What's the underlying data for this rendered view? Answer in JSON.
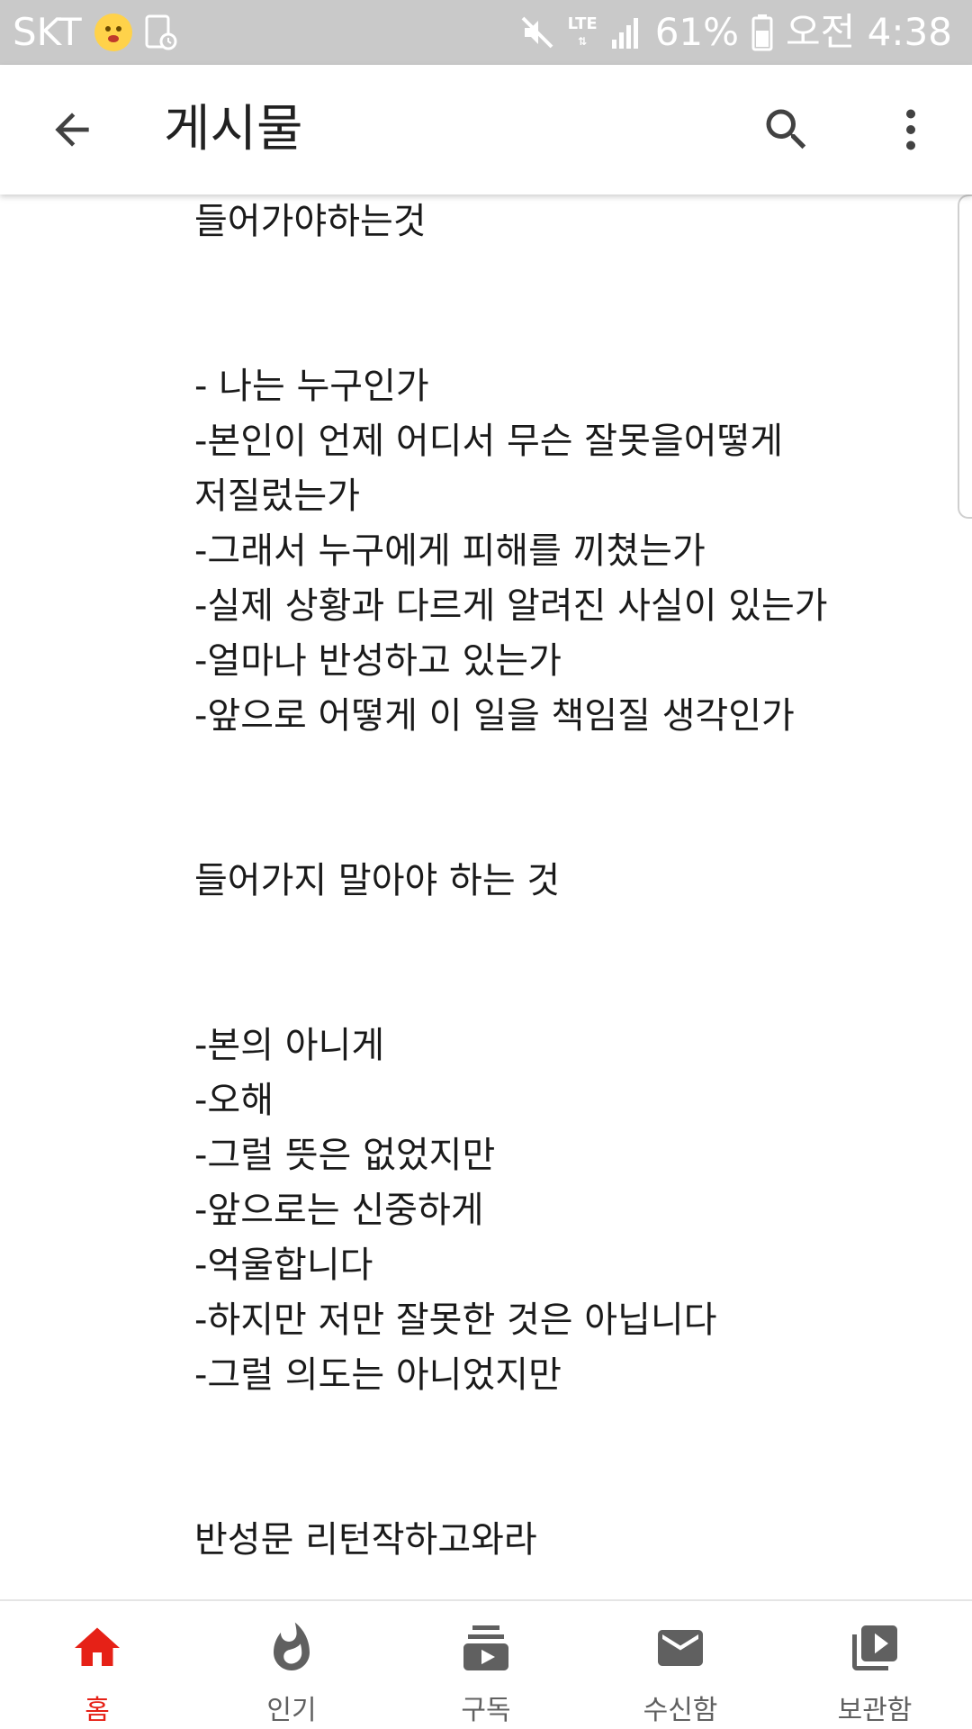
{
  "status_bar": {
    "carrier": "SKT",
    "lte": "LTE",
    "battery": "61%",
    "time": "오전 4:38",
    "icons": [
      "emoji-face-icon",
      "screenshot-app-icon",
      "mute-icon",
      "signal-icon",
      "battery-icon"
    ]
  },
  "app_bar": {
    "title": "게시물",
    "icons": [
      "back-arrow-icon",
      "search-icon",
      "more-vert-icon"
    ]
  },
  "post": {
    "lines": [
      "들어가야하는것",
      "",
      "",
      "- 나는 누구인가",
      "-본인이 언제 어디서 무슨 잘못을어떻게",
      "저질렀는가",
      "-그래서 누구에게 피해를 끼쳤는가",
      "-실제 상황과 다르게 알려진 사실이 있는가",
      "-얼마나 반성하고 있는가",
      "-앞으로 어떻게 이 일을 책임질 생각인가",
      "",
      "",
      "들어가지 말아야 하는 것",
      "",
      "",
      "-본의 아니게",
      "-오해",
      "-그럴 뜻은 없었지만",
      "-앞으로는 신중하게",
      "-억울합니다",
      "-하지만 저만 잘못한 것은 아닙니다",
      "-그럴 의도는 아니었지만",
      "",
      "",
      "반성문 리턴작하고와라"
    ]
  },
  "bottom_nav": {
    "active_color": "#e62117",
    "inactive_color": "#606060",
    "items": [
      {
        "label": "홈",
        "icon": "home-icon",
        "active": true
      },
      {
        "label": "인기",
        "icon": "trending-flame-icon",
        "active": false
      },
      {
        "label": "구독",
        "icon": "subscriptions-icon",
        "active": false
      },
      {
        "label": "수신함",
        "icon": "inbox-mail-icon",
        "active": false
      },
      {
        "label": "보관함",
        "icon": "library-icon",
        "active": false
      }
    ]
  }
}
